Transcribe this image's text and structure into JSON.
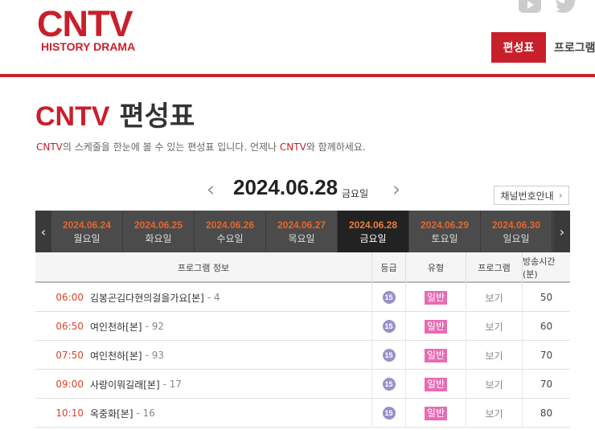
{
  "header": {
    "logo_main": "CNTV",
    "logo_sub": "HISTORY DRAMA",
    "nav_active": "편성표",
    "nav_next": "프로그램"
  },
  "page": {
    "title_brand": "CNTV",
    "title_rest": "편성표",
    "desc_brand1": "CNTV",
    "desc_mid": "의 스케줄을 한눈에 볼 수 있는 편성표 입니다. 언제나 ",
    "desc_brand2": "CNTV",
    "desc_end": "와 함께하세요."
  },
  "date_header": {
    "prev": "‹",
    "next": "›",
    "date": "2024.06.28",
    "dow": "금요일",
    "channel_btn": "채널번호안내",
    "channel_arrow": "›"
  },
  "days": [
    {
      "date": "2024.06.24",
      "dow": "월요일"
    },
    {
      "date": "2024.06.25",
      "dow": "화요일"
    },
    {
      "date": "2024.06.26",
      "dow": "수요일"
    },
    {
      "date": "2024.06.27",
      "dow": "목요일"
    },
    {
      "date": "2024.06.28",
      "dow": "금요일",
      "active": true
    },
    {
      "date": "2024.06.29",
      "dow": "토요일"
    },
    {
      "date": "2024.06.30",
      "dow": "일요일"
    }
  ],
  "day_arrows": {
    "left": "‹",
    "right": "›"
  },
  "table": {
    "headers": [
      "프로그램 정보",
      "등급",
      "유형",
      "프로그램",
      "방송시간 (분)"
    ],
    "rows": [
      {
        "time": "06:00",
        "title": "김봉곤김다현의걸을가요[본]",
        "ep": "- 4",
        "grade": "15",
        "type": "일반",
        "program": "보기",
        "duration": "50"
      },
      {
        "time": "06:50",
        "title": "여인천하[본]",
        "ep": "- 92",
        "grade": "15",
        "type": "일반",
        "program": "보기",
        "duration": "60"
      },
      {
        "time": "07:50",
        "title": "여인천하[본]",
        "ep": "- 93",
        "grade": "15",
        "type": "일반",
        "program": "보기",
        "duration": "70"
      },
      {
        "time": "09:00",
        "title": "사랑이뭐길래[본]",
        "ep": "- 17",
        "grade": "15",
        "type": "일반",
        "program": "보기",
        "duration": "70"
      },
      {
        "time": "10:10",
        "title": "옥중화[본]",
        "ep": "- 16",
        "grade": "15",
        "type": "일반",
        "program": "보기",
        "duration": "80"
      }
    ]
  },
  "colors": {
    "brand": "#c8202b",
    "time": "#d8452b",
    "grade": "#9b8fc7",
    "type": "#e86bb4"
  },
  "icons": [
    "youtube-icon",
    "twitter-icon"
  ]
}
